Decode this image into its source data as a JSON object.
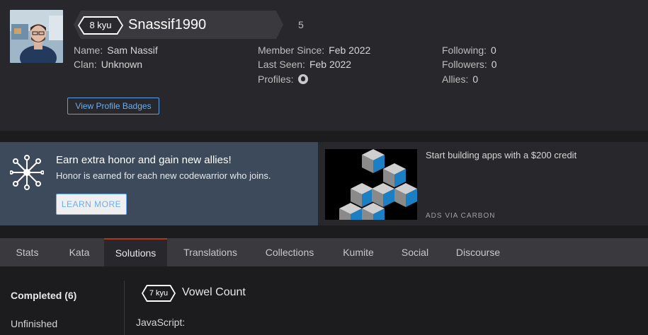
{
  "profile": {
    "rank": "8 kyu",
    "username": "Snassif1990",
    "honor": "5",
    "fields": {
      "name_label": "Name:",
      "name_value": "Sam Nassif",
      "clan_label": "Clan:",
      "clan_value": "Unknown",
      "member_label": "Member Since:",
      "member_value": "Feb 2022",
      "seen_label": "Last Seen:",
      "seen_value": "Feb 2022",
      "profiles_label": "Profiles:",
      "following_label": "Following:",
      "following_value": "0",
      "followers_label": "Followers:",
      "followers_value": "0",
      "allies_label": "Allies:",
      "allies_value": "0"
    },
    "badges_button": "View Profile Badges"
  },
  "promo": {
    "title": "Earn extra honor and gain new allies!",
    "subtitle": "Honor is earned for each new codewarrior who joins.",
    "button": "LEARN MORE"
  },
  "ad": {
    "text": "Start building apps with a $200 credit",
    "label": "ADS VIA CARBON"
  },
  "tabs": [
    "Stats",
    "Kata",
    "Solutions",
    "Translations",
    "Collections",
    "Kumite",
    "Social",
    "Discourse"
  ],
  "active_tab": "Solutions",
  "sidebar": {
    "completed": "Completed (6)",
    "unfinished": "Unfinished"
  },
  "solution": {
    "rank": "7 kyu",
    "kata_name": "Vowel Count",
    "language": "JavaScript:"
  },
  "colors": {
    "accent_blue": "#6aaef0",
    "active_tab_border": "#b1361e",
    "promo_bg": "#3c4a5c"
  }
}
